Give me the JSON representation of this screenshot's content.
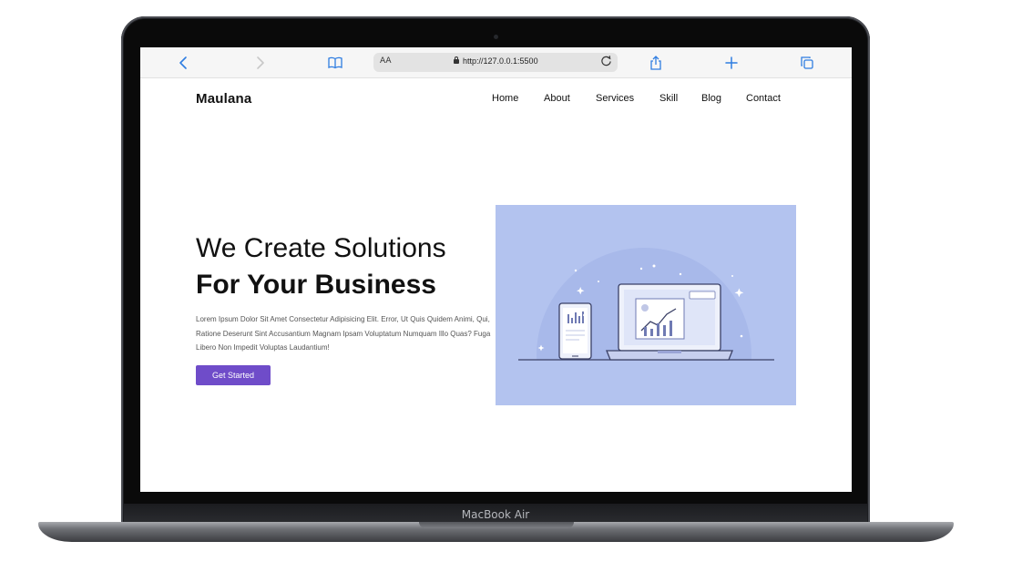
{
  "device": {
    "label": "MacBook Air"
  },
  "browser": {
    "text_size_label": "AA",
    "url": "http://127.0.0.1:5500",
    "icons": {
      "back": "chevron-left-icon",
      "forward": "chevron-right-icon",
      "bookmarks": "book-icon",
      "reload": "reload-icon",
      "share": "share-icon",
      "new_tab": "plus-icon",
      "tabs": "tabs-icon"
    },
    "accent_color": "#2f7de1"
  },
  "site": {
    "logo": "Maulana",
    "nav": [
      "Home",
      "About",
      "Services",
      "Skill",
      "Blog",
      "Contact"
    ],
    "hero": {
      "title_line1": "We Create Solutions",
      "title_line2": "For Your Business",
      "description": "Lorem Ipsum Dolor Sit Amet Consectetur Adipisicing Elit. Error, Ut Quis Quidem Animi, Qui, Ratione Deserunt Sint Accusantium Magnam Ipsam Voluptatum Numquam Illo Quas? Fuga Libero Non Impedit Voluptas Laudantium!",
      "cta_label": "Get Started"
    },
    "colors": {
      "primary": "#6f4cc9",
      "illustration_bg": "#b3c3ef"
    }
  }
}
